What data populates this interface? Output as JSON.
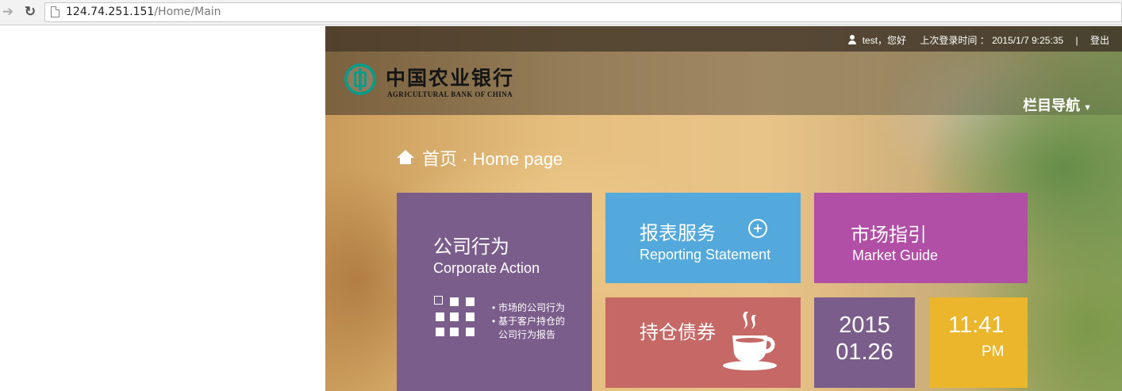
{
  "browser": {
    "url_host": "124.74.251.151",
    "url_path": "/Home/Main",
    "back_icon": "back-arrow-icon",
    "reload_icon": "reload-icon"
  },
  "topbar": {
    "user": "test",
    "greeting": "，您好",
    "last_login_label": "上次登录时间 ：",
    "last_login_time": "2015/1/7 9:25:35",
    "separator": "|",
    "logout": "登出"
  },
  "header": {
    "logo_cn": "中国农业银行",
    "logo_en": "AGRICULTURAL BANK OF CHINA",
    "nav_menu": "栏目导航",
    "brand_color": "#0d9a86"
  },
  "breadcrumb": {
    "text": "首页 · Home page"
  },
  "tiles": {
    "corporate": {
      "cn": "公司行为",
      "en": "Corporate Action",
      "bullets": [
        "市场的公司行为",
        "基于客户持仓的",
        "公司行为报告"
      ],
      "color": "#7b5d8c"
    },
    "reporting": {
      "cn": "报表服务",
      "en": "Reporting Statement",
      "color": "#53a8dc"
    },
    "market": {
      "cn": "市场指引",
      "en": "Market Guide",
      "color": "#b14ea5"
    },
    "holdings": {
      "cn": "持仓债券",
      "color": "#c56866"
    },
    "date": {
      "year": "2015",
      "month_day": "01.26",
      "color": "#7b5d8c"
    },
    "time": {
      "clock": "11:41",
      "ampm": "PM",
      "color": "#ebb62c"
    }
  }
}
